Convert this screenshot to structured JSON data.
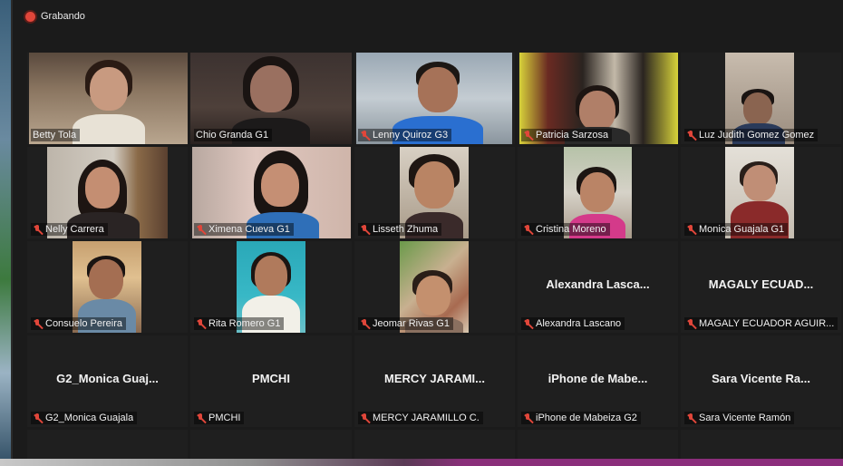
{
  "recording": {
    "label": "Grabando"
  },
  "participants": [
    {
      "name": "Betty Tola"
    },
    {
      "name": "Chio Granda G1"
    },
    {
      "name": "Lenny Quiroz G3"
    },
    {
      "name": "Patricia Sarzosa"
    },
    {
      "name": "Luz Judith Gomez Gomez"
    },
    {
      "name": "Nelly Carrera"
    },
    {
      "name": "Ximena Cueva G1"
    },
    {
      "name": "Lisseth Zhuma"
    },
    {
      "name": "Cristina Moreno"
    },
    {
      "name": "Monica Guajala G1"
    },
    {
      "name": "Consuelo Pereira"
    },
    {
      "name": "Rita Romero G1"
    },
    {
      "name": "Jeomar Rivas G1"
    },
    {
      "name": "Alexandra Lascano",
      "display": "Alexandra  Lasca..."
    },
    {
      "name": "MAGALY ECUADOR AGUIR...",
      "display": "MAGALY  ECUAD..."
    },
    {
      "name": "G2_Monica Guajala",
      "display": "G2_Monica  Guaj..."
    },
    {
      "name": "PMCHI",
      "display": "PMCHI"
    },
    {
      "name": "MERCY JARAMILLO C.",
      "display": "MERCY  JARAMI..."
    },
    {
      "name": "iPhone de Mabeiza G2",
      "display": "iPhone  de  Mabe..."
    },
    {
      "name": "Sara Vicente Ramón",
      "display": "Sara  Vicente  Ra..."
    }
  ],
  "colors": {
    "recording": "#e0463a",
    "active_speaker": "#d7e34a",
    "muted": "#e0463a"
  }
}
